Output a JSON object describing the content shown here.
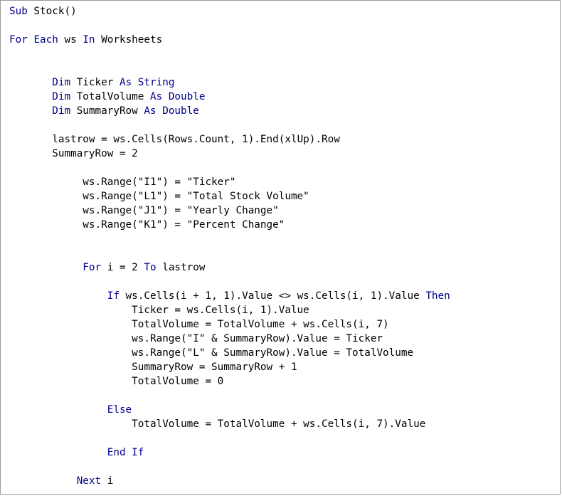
{
  "editor": {
    "name": "vba-code-editor",
    "keyword_color": "#00008b",
    "text_color": "#000000",
    "lines": [
      {
        "indent": 0,
        "tokens": [
          {
            "t": "Sub",
            "kw": true
          },
          {
            "t": " Stock()"
          }
        ]
      },
      {
        "indent": 0,
        "tokens": []
      },
      {
        "indent": 0,
        "tokens": [
          {
            "t": "For",
            "kw": true
          },
          {
            "t": " "
          },
          {
            "t": "Each",
            "kw": true
          },
          {
            "t": " ws "
          },
          {
            "t": "In",
            "kw": true
          },
          {
            "t": " Worksheets"
          }
        ]
      },
      {
        "indent": 0,
        "tokens": []
      },
      {
        "indent": 0,
        "tokens": []
      },
      {
        "indent": 7,
        "tokens": [
          {
            "t": "Dim",
            "kw": true
          },
          {
            "t": " Ticker "
          },
          {
            "t": "As",
            "kw": true
          },
          {
            "t": " "
          },
          {
            "t": "String",
            "kw": true
          }
        ]
      },
      {
        "indent": 7,
        "tokens": [
          {
            "t": "Dim",
            "kw": true
          },
          {
            "t": " TotalVolume "
          },
          {
            "t": "As",
            "kw": true
          },
          {
            "t": " "
          },
          {
            "t": "Double",
            "kw": true
          }
        ]
      },
      {
        "indent": 7,
        "tokens": [
          {
            "t": "Dim",
            "kw": true
          },
          {
            "t": " SummaryRow "
          },
          {
            "t": "As",
            "kw": true
          },
          {
            "t": " "
          },
          {
            "t": "Double",
            "kw": true
          }
        ]
      },
      {
        "indent": 0,
        "tokens": []
      },
      {
        "indent": 7,
        "tokens": [
          {
            "t": "lastrow = ws.Cells(Rows.Count, 1).End(xlUp).Row"
          }
        ]
      },
      {
        "indent": 7,
        "tokens": [
          {
            "t": "SummaryRow = 2"
          }
        ]
      },
      {
        "indent": 0,
        "tokens": []
      },
      {
        "indent": 12,
        "tokens": [
          {
            "t": "ws.Range(\"I1\") = \"Ticker\""
          }
        ]
      },
      {
        "indent": 12,
        "tokens": [
          {
            "t": "ws.Range(\"L1\") = \"Total Stock Volume\""
          }
        ]
      },
      {
        "indent": 12,
        "tokens": [
          {
            "t": "ws.Range(\"J1\") = \"Yearly Change\""
          }
        ]
      },
      {
        "indent": 12,
        "tokens": [
          {
            "t": "ws.Range(\"K1\") = \"Percent Change\""
          }
        ]
      },
      {
        "indent": 0,
        "tokens": []
      },
      {
        "indent": 0,
        "tokens": []
      },
      {
        "indent": 12,
        "tokens": [
          {
            "t": "For",
            "kw": true
          },
          {
            "t": " i = 2 "
          },
          {
            "t": "To",
            "kw": true
          },
          {
            "t": " lastrow"
          }
        ]
      },
      {
        "indent": 0,
        "tokens": []
      },
      {
        "indent": 16,
        "tokens": [
          {
            "t": "If",
            "kw": true
          },
          {
            "t": " ws.Cells(i + 1, 1).Value <> ws.Cells(i, 1).Value "
          },
          {
            "t": "Then",
            "kw": true
          }
        ]
      },
      {
        "indent": 20,
        "tokens": [
          {
            "t": "Ticker = ws.Cells(i, 1).Value"
          }
        ]
      },
      {
        "indent": 20,
        "tokens": [
          {
            "t": "TotalVolume = TotalVolume + ws.Cells(i, 7)"
          }
        ]
      },
      {
        "indent": 20,
        "tokens": [
          {
            "t": "ws.Range(\"I\" & SummaryRow).Value = Ticker"
          }
        ]
      },
      {
        "indent": 20,
        "tokens": [
          {
            "t": "ws.Range(\"L\" & SummaryRow).Value = TotalVolume"
          }
        ]
      },
      {
        "indent": 20,
        "tokens": [
          {
            "t": "SummaryRow = SummaryRow + 1"
          }
        ]
      },
      {
        "indent": 20,
        "tokens": [
          {
            "t": "TotalVolume = 0"
          }
        ]
      },
      {
        "indent": 0,
        "tokens": []
      },
      {
        "indent": 16,
        "tokens": [
          {
            "t": "Else",
            "kw": true
          }
        ]
      },
      {
        "indent": 20,
        "tokens": [
          {
            "t": "TotalVolume = TotalVolume + ws.Cells(i, 7).Value"
          }
        ]
      },
      {
        "indent": 0,
        "tokens": []
      },
      {
        "indent": 16,
        "tokens": [
          {
            "t": "End",
            "kw": true
          },
          {
            "t": " "
          },
          {
            "t": "If",
            "kw": true
          }
        ]
      },
      {
        "indent": 0,
        "tokens": []
      },
      {
        "indent": 11,
        "tokens": [
          {
            "t": "Next",
            "kw": true
          },
          {
            "t": " i"
          }
        ]
      }
    ]
  }
}
